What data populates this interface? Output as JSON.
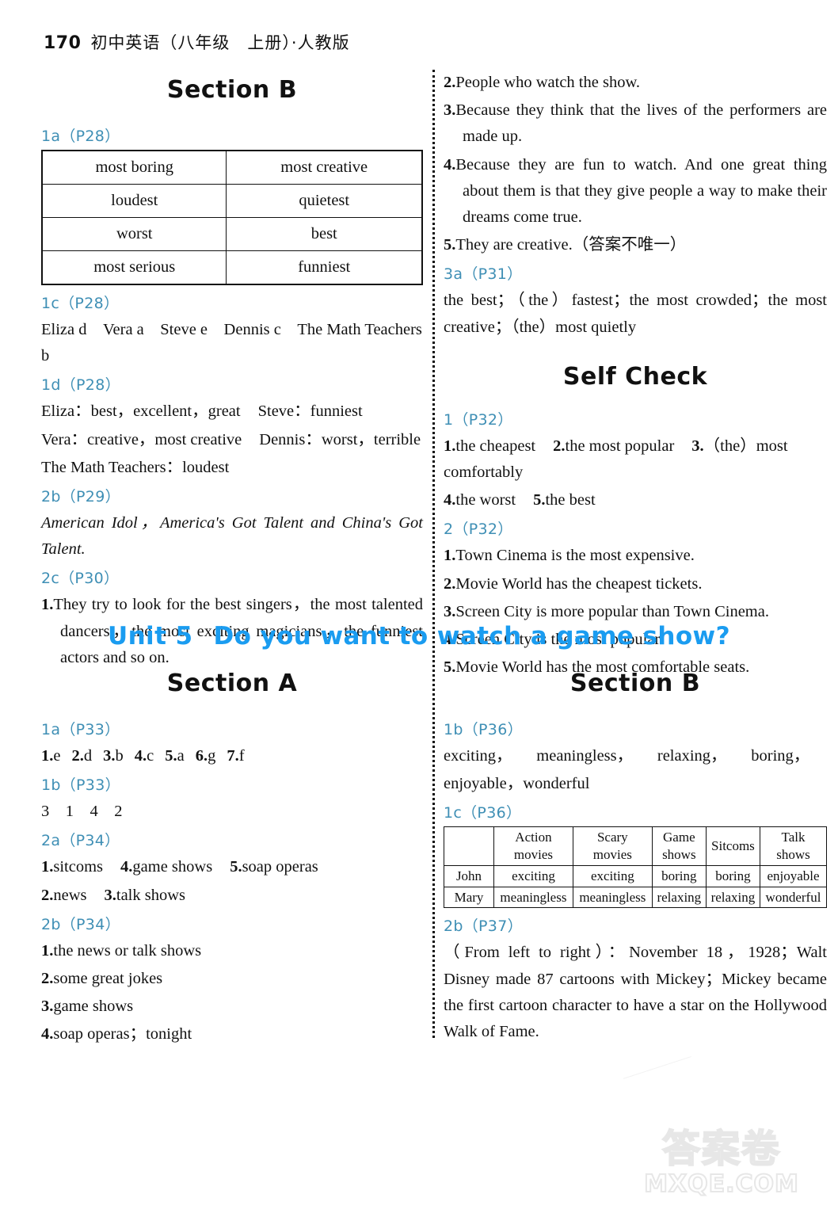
{
  "header": {
    "page_number": "170",
    "title": "初中英语（八年级　上册）·人教版"
  },
  "unit_banner": {
    "unit_label": "Unit 5",
    "unit_title": "Do you want to watch a game show?"
  },
  "left_top": {
    "section_title": "Section B",
    "ref_1a": "1a（P28）",
    "table_1a": {
      "rows": [
        [
          "most boring",
          "most creative"
        ],
        [
          "loudest",
          "quietest"
        ],
        [
          "worst",
          "best"
        ],
        [
          "most serious",
          "funniest"
        ]
      ]
    },
    "ref_1c": "1c（P28）",
    "line_1c": "Eliza d　Vera a　Steve e　Dennis c　The Math Teachers b",
    "ref_1d": "1d（P28）",
    "line_1d_1_a": "Eliza：best，excellent，great",
    "line_1d_1_b": "Steve：funniest",
    "line_1d_2_a": "Vera：creative，most creative",
    "line_1d_2_b": "Dennis：worst，terrible",
    "line_1d_3": "The Math Teachers：loudest",
    "ref_2b": "2b（P29）",
    "line_2b": "American Idol，America's Got Talent and China's Got Talent.",
    "ref_2c": "2c（P30）",
    "item_2c_1_num": "1.",
    "item_2c_1_text": "They try to look for the best singers，the most talented dancers，the most exciting magicians，the funniest actors and so on."
  },
  "right_top": {
    "item_2_num": "2.",
    "item_2_text": "People who watch the show.",
    "item_3_num": "3.",
    "item_3_text": "Because they think that the lives of the performers are made up.",
    "item_4_num": "4.",
    "item_4_text": "Because they are fun to watch. And one great thing about them is that they give people a way to make their dreams come true.",
    "item_5_num": "5.",
    "item_5_text": "They are creative.（答案不唯一）",
    "ref_3a": "3a（P31）",
    "line_3a": "the best；（the）fastest；the most crowded；the most creative；（the）most quietly",
    "self_check_title": "Self Check",
    "ref_sc1": "1（P32）",
    "sc1_line1": [
      {
        "num": "1.",
        "text": "the cheapest"
      },
      {
        "num": "2.",
        "text": "the most popular"
      },
      {
        "num": "3.",
        "text": "（the）most comfortably"
      }
    ],
    "sc1_line2": [
      {
        "num": "4.",
        "text": "the worst"
      },
      {
        "num": "5.",
        "text": "the best"
      }
    ],
    "ref_sc2": "2（P32）",
    "sc2_items": [
      {
        "num": "1.",
        "text": "Town Cinema is the most expensive."
      },
      {
        "num": "2.",
        "text": "Movie World has the cheapest tickets."
      },
      {
        "num": "3.",
        "text": "Screen City is more popular than Town Cinema."
      },
      {
        "num": "4.",
        "text": "Screen City is the most popular."
      },
      {
        "num": "5.",
        "text": "Movie World has the most comfortable seats."
      }
    ]
  },
  "left_bottom": {
    "section_title": "Section A",
    "ref_1a": "1a（P33）",
    "line_1a": [
      {
        "num": "1.",
        "text": "e"
      },
      {
        "num": "2.",
        "text": "d"
      },
      {
        "num": "3.",
        "text": "b"
      },
      {
        "num": "4.",
        "text": "c"
      },
      {
        "num": "5.",
        "text": "a"
      },
      {
        "num": "6.",
        "text": "g"
      },
      {
        "num": "7.",
        "text": "f"
      }
    ],
    "ref_1b": "1b（P33）",
    "line_1b": "3　1　4　2",
    "ref_2a": "2a（P34）",
    "line_2a_1": [
      {
        "num": "1.",
        "text": "sitcoms"
      },
      {
        "num": "4.",
        "text": "game shows"
      },
      {
        "num": "5.",
        "text": "soap operas"
      }
    ],
    "line_2a_2": [
      {
        "num": "2.",
        "text": "news"
      },
      {
        "num": "3.",
        "text": "talk shows"
      }
    ],
    "ref_2b": "2b（P34）",
    "items_2b": [
      {
        "num": "1.",
        "text": "the news or talk shows"
      },
      {
        "num": "2.",
        "text": "some great jokes"
      },
      {
        "num": "3.",
        "text": "game shows"
      },
      {
        "num": "4.",
        "text": "soap operas；tonight"
      }
    ]
  },
  "right_bottom": {
    "section_title": "Section B",
    "ref_1b": "1b（P36）",
    "line_1b_1": "exciting，　　meaningless，　　relaxing，　　boring，",
    "line_1b_2": "enjoyable，wonderful",
    "ref_1c": "1c（P36）",
    "table_1c": {
      "headers": [
        "",
        "Action\nmovies",
        "Scary\nmovies",
        "Game\nshows",
        "Sitcoms",
        "Talk\nshows"
      ],
      "rows": [
        [
          "John",
          "exciting",
          "exciting",
          "boring",
          "boring",
          "enjoyable"
        ],
        [
          "Mary",
          "meaningless",
          "meaningless",
          "relaxing",
          "relaxing",
          "wonderful"
        ]
      ]
    },
    "ref_2b": "2b（P37）",
    "line_2b": "（From left to right）：November 18，1928；Walt Disney made 87 cartoons with Mickey；Mickey became the first cartoon character to have a star on the Hollywood Walk of Fame."
  },
  "watermark": {
    "chinese": "答案卷",
    "english": "MXQE.COM"
  },
  "colors": {
    "ref_blue": "#3f8fb5",
    "unit_blue": "#1a9cf0",
    "text_black": "#111111",
    "watermark_gray": "#e3e3e3"
  }
}
